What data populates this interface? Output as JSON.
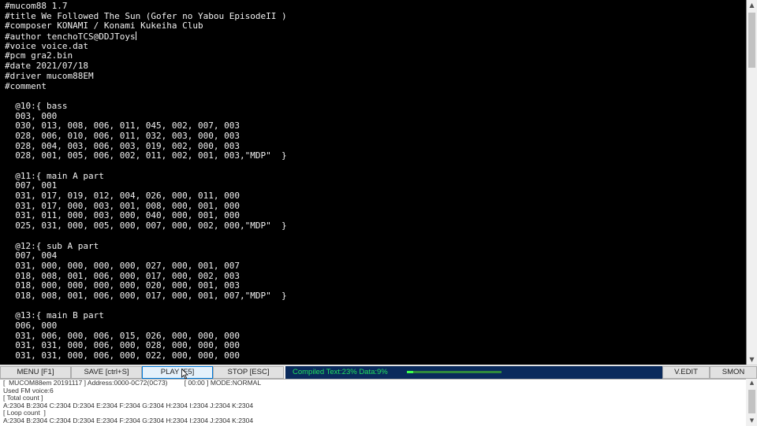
{
  "editor": {
    "lines": [
      "#mucom88 1.7",
      "#title We Followed The Sun (Gofer no Yabou EpisodeII )",
      "#composer KONAMI / Konami Kukeiha Club",
      "#author tenchoTCS@DDJToys",
      "#voice voice.dat",
      "#pcm gra2.bin",
      "#date 2021/07/18",
      "#driver mucom88EM",
      "#comment",
      "",
      "  @10:{ bass",
      "  003, 000",
      "  030, 013, 008, 006, 011, 045, 002, 007, 003",
      "  028, 006, 010, 006, 011, 032, 003, 000, 003",
      "  028, 004, 003, 006, 003, 019, 002, 000, 003",
      "  028, 001, 005, 006, 002, 011, 002, 001, 003,\"MDP\"  }",
      "",
      "  @11:{ main A part",
      "  007, 001",
      "  031, 017, 019, 012, 004, 026, 000, 011, 000",
      "  031, 017, 000, 003, 001, 008, 000, 001, 000",
      "  031, 011, 000, 003, 000, 040, 000, 001, 000",
      "  025, 031, 000, 005, 000, 007, 000, 002, 000,\"MDP\"  }",
      "",
      "  @12:{ sub A part",
      "  007, 004",
      "  031, 000, 000, 000, 000, 027, 000, 001, 007",
      "  018, 008, 001, 006, 000, 017, 000, 002, 003",
      "  018, 000, 000, 000, 000, 020, 000, 001, 003",
      "  018, 008, 001, 006, 000, 017, 000, 001, 007,\"MDP\"  }",
      "",
      "  @13:{ main B part",
      "  006, 000",
      "  031, 006, 000, 006, 015, 026, 000, 000, 000",
      "  031, 031, 000, 006, 000, 028, 000, 000, 000",
      "  031, 031, 000, 006, 000, 022, 000, 000, 000"
    ]
  },
  "toolbar": {
    "menu": "MENU [F1]",
    "save": "SAVE [ctrl+S]",
    "play": "PLAY [F5]",
    "stop": "STOP [ESC]",
    "vedit": "V.EDIT",
    "smon": "SMON"
  },
  "status": {
    "compiled_text": "Compiled Text:23% Data:9%",
    "progress_fraction": 0.07
  },
  "log": {
    "lines": [
      "[  MUCOM88em 20191117 ] Address:0000-0C72(0C73)         [ 00:00 ] MODE:NORMAL",
      "Used FM voice:6",
      "[ Total count ]",
      "A:2304 B:2304 C:2304 D:2304 E:2304 F:2304 G:2304 H:2304 I:2304 J:2304 K:2304",
      "[ Loop count  ]",
      "A:2304 B:2304 C:2304 D:2304 E:2304 F:2304 G:2304 H:2304 I:2304 J:2304 K:2304"
    ]
  },
  "colors": {
    "editor_bg": "#000000",
    "editor_text": "#f2f2f2",
    "status_panel": "#0a2a5c",
    "status_text": "#22e060"
  }
}
